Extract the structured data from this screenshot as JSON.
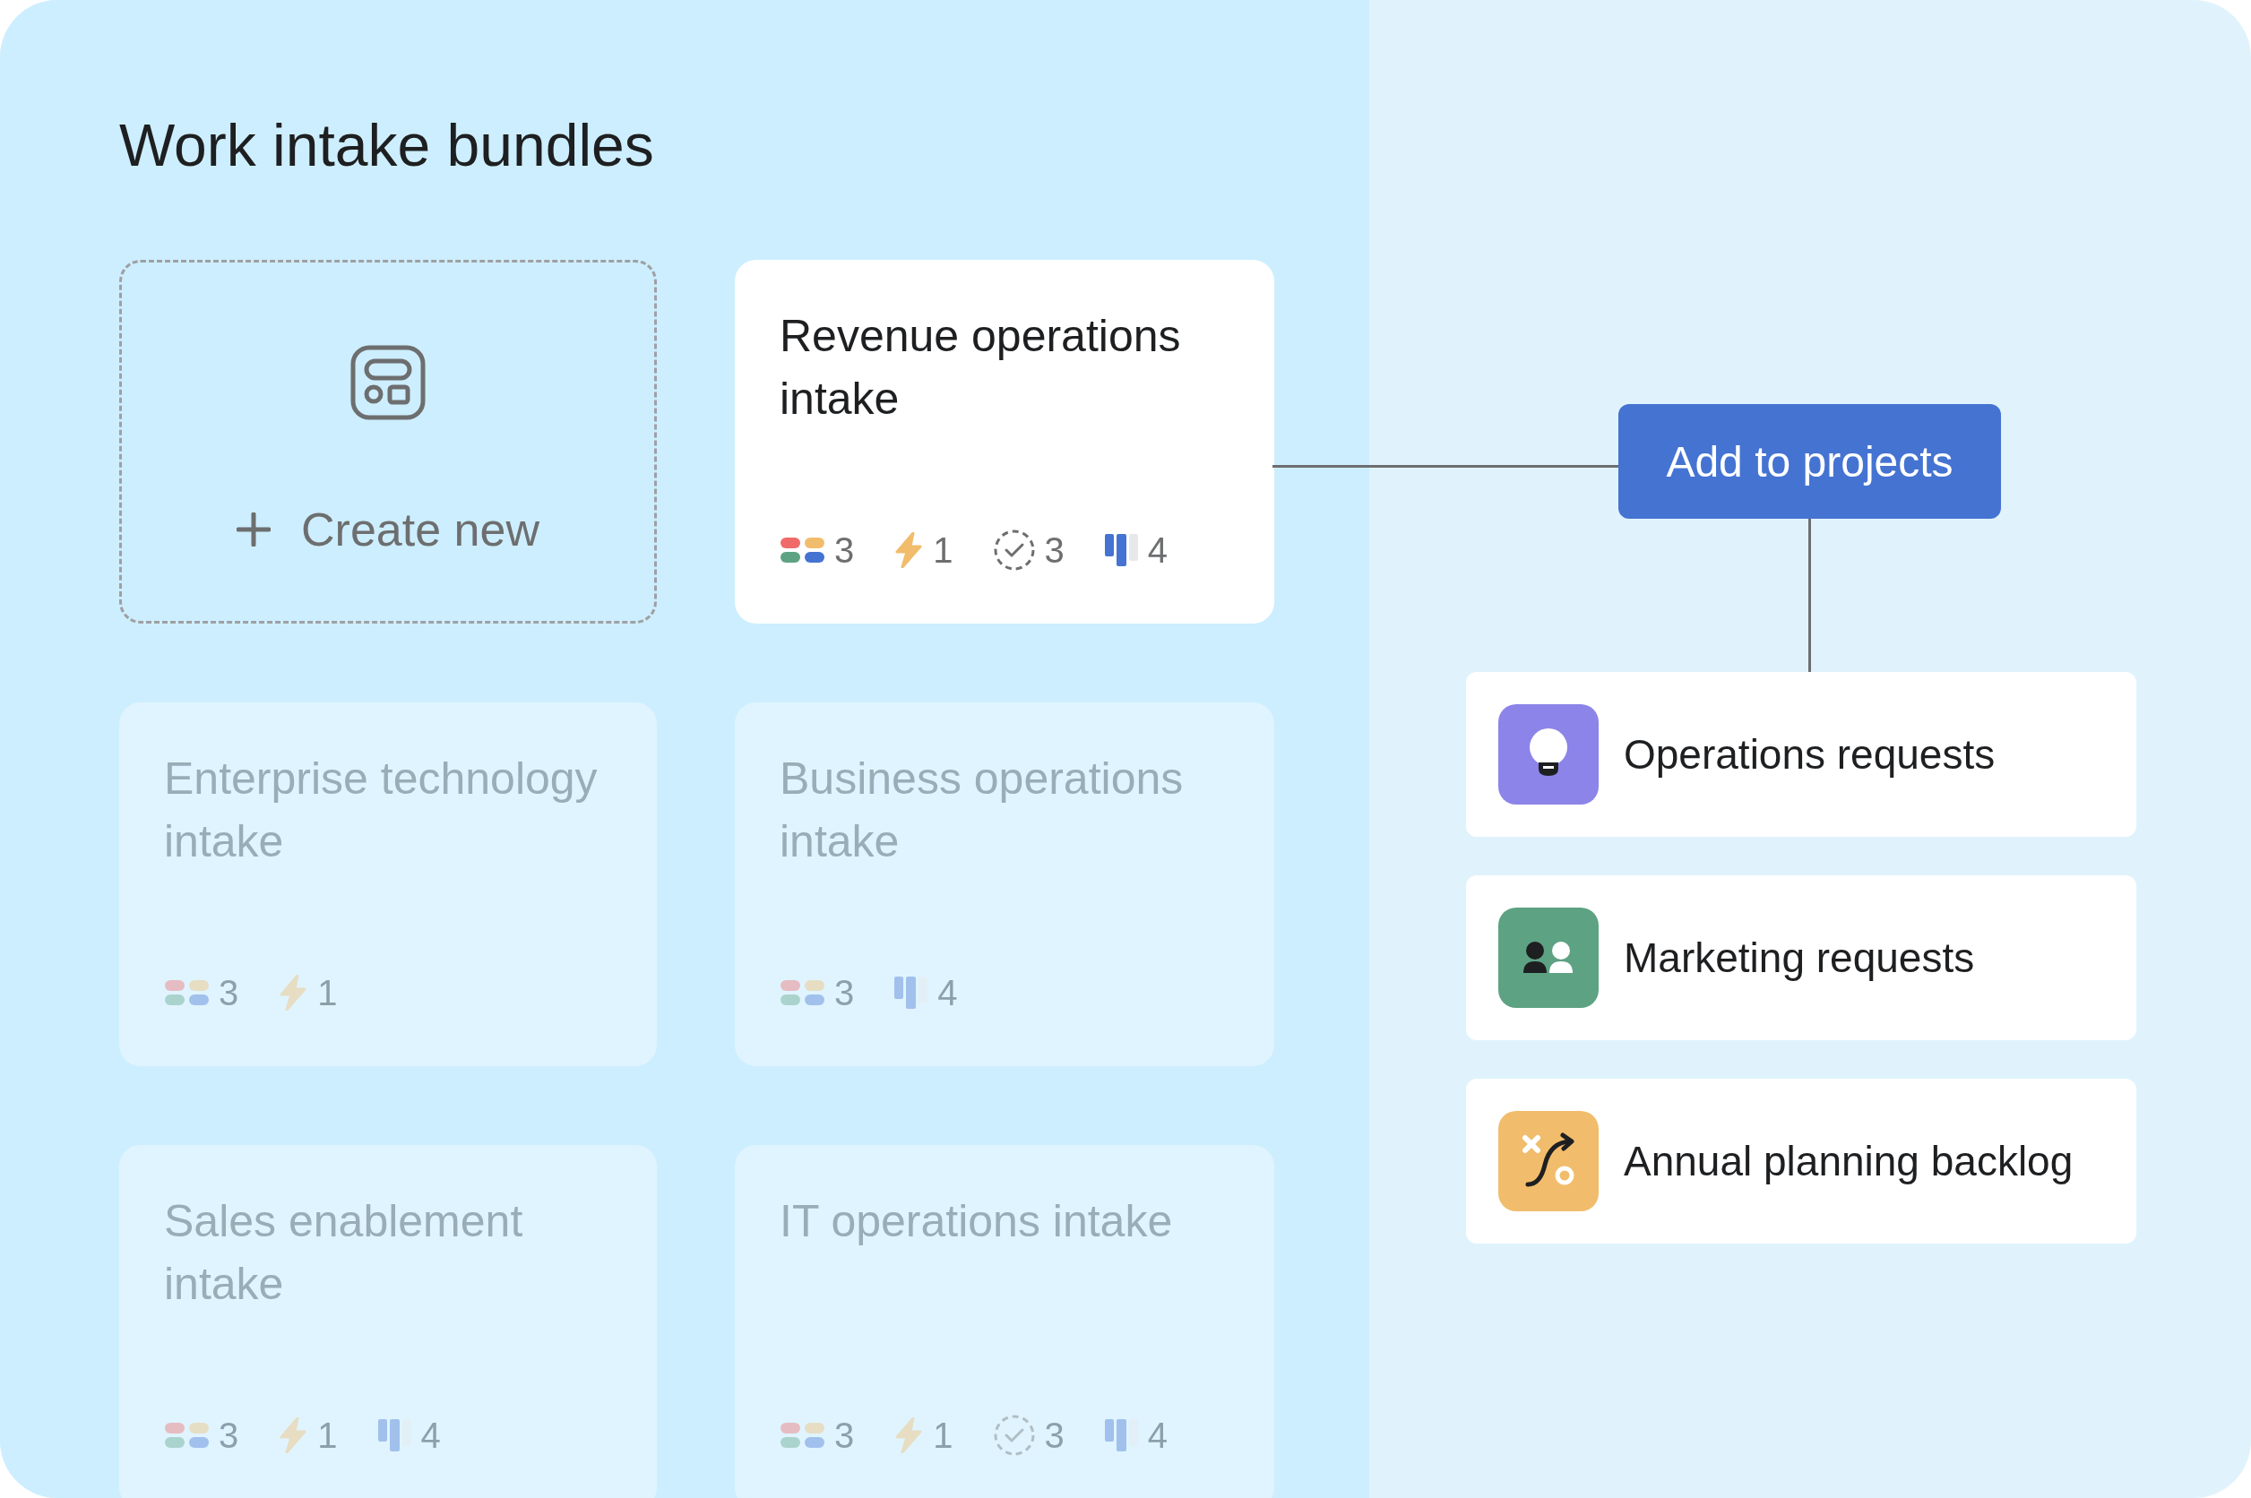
{
  "title": "Work intake bundles",
  "create_card": {
    "label": "Create new"
  },
  "bundles": [
    {
      "title": "Revenue operations intake",
      "dimmed": false,
      "metrics": [
        {
          "kind": "fields",
          "count": "3"
        },
        {
          "kind": "rules",
          "count": "1"
        },
        {
          "kind": "tasks",
          "count": "3"
        },
        {
          "kind": "views",
          "count": "4"
        }
      ]
    },
    {
      "title": "Enterprise technology intake",
      "dimmed": true,
      "metrics": [
        {
          "kind": "fields",
          "count": "3"
        },
        {
          "kind": "rules",
          "count": "1"
        }
      ]
    },
    {
      "title": "Business operations intake",
      "dimmed": true,
      "metrics": [
        {
          "kind": "fields",
          "count": "3"
        },
        {
          "kind": "views",
          "count": "4"
        }
      ]
    },
    {
      "title": "Sales enablement intake",
      "dimmed": true,
      "metrics": [
        {
          "kind": "fields",
          "count": "3"
        },
        {
          "kind": "rules",
          "count": "1"
        },
        {
          "kind": "views",
          "count": "4"
        }
      ]
    },
    {
      "title": "IT operations intake",
      "dimmed": true,
      "metrics": [
        {
          "kind": "fields",
          "count": "3"
        },
        {
          "kind": "rules",
          "count": "1"
        },
        {
          "kind": "tasks",
          "count": "3"
        },
        {
          "kind": "views",
          "count": "4"
        }
      ]
    }
  ],
  "action_button": "Add to projects",
  "projects": [
    {
      "name": "Operations requests",
      "kind": "idea",
      "color": "#8c84e8"
    },
    {
      "name": "Marketing requests",
      "kind": "team",
      "color": "#5da283"
    },
    {
      "name": "Annual planning backlog",
      "kind": "strategy",
      "color": "#f1bd6c"
    }
  ]
}
